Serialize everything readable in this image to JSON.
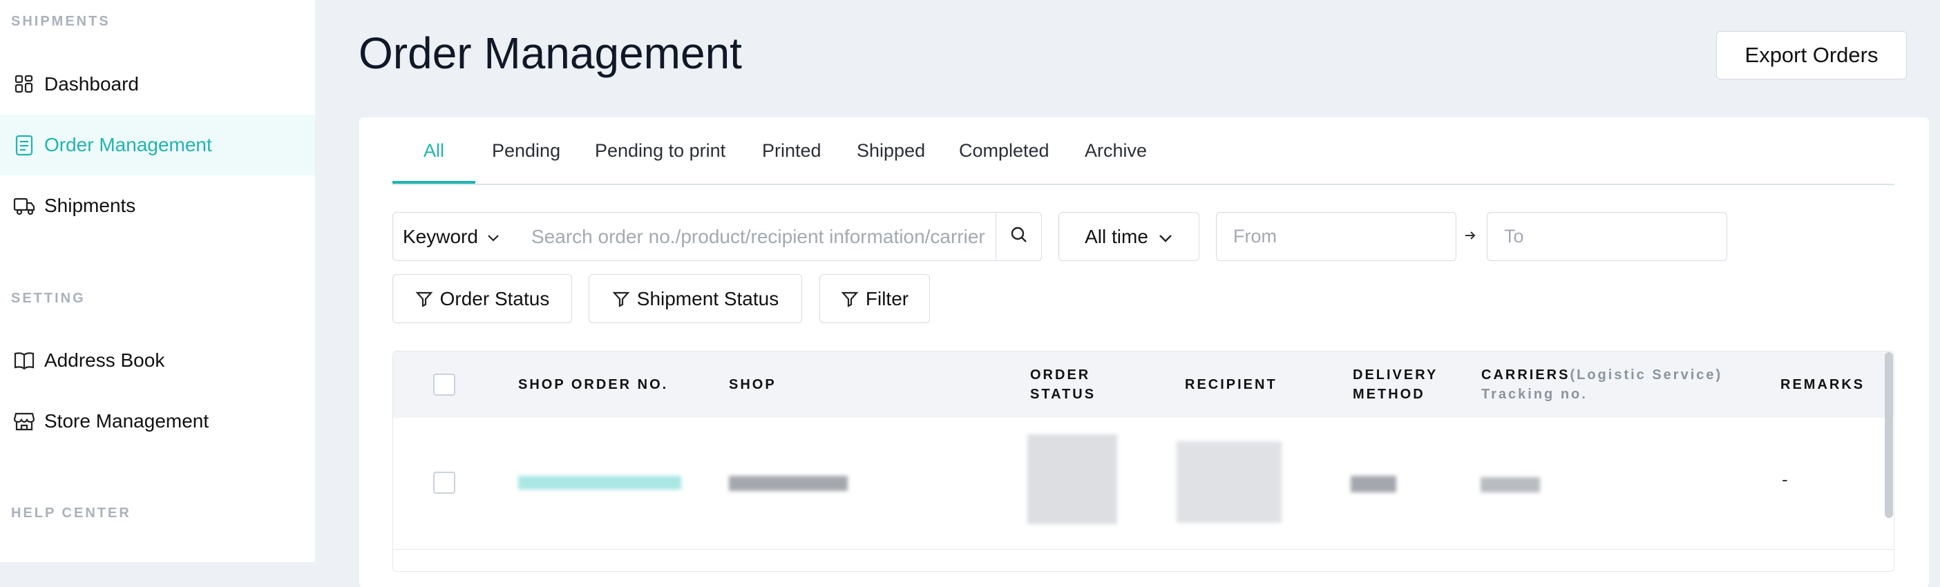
{
  "sidebar": {
    "sections": [
      {
        "label": "SHIPMENTS"
      },
      {
        "label": "SETTING"
      },
      {
        "label": "HELP CENTER"
      }
    ],
    "items": [
      {
        "label": "Dashboard",
        "icon": "dashboard-icon",
        "active": false
      },
      {
        "label": "Order Management",
        "icon": "clipboard-icon",
        "active": true
      },
      {
        "label": "Shipments",
        "icon": "truck-icon",
        "active": false
      },
      {
        "label": "Address Book",
        "icon": "book-icon",
        "active": false
      },
      {
        "label": "Store Management",
        "icon": "store-icon",
        "active": false
      }
    ]
  },
  "header": {
    "title": "Order Management",
    "export_label": "Export Orders"
  },
  "tabs": [
    {
      "label": "All",
      "active": true
    },
    {
      "label": "Pending"
    },
    {
      "label": "Pending to print"
    },
    {
      "label": "Printed"
    },
    {
      "label": "Shipped"
    },
    {
      "label": "Completed"
    },
    {
      "label": "Archive"
    }
  ],
  "search": {
    "keyword_label": "Keyword",
    "placeholder": "Search order no./product/recipient information/carrier",
    "time_label": "All time",
    "from_placeholder": "From",
    "to_placeholder": "To"
  },
  "filters": {
    "order_status": "Order Status",
    "shipment_status": "Shipment Status",
    "filter": "Filter"
  },
  "table": {
    "columns": {
      "shop_order_no": "SHOP ORDER NO.",
      "shop": "SHOP",
      "order_status_1": "ORDER",
      "order_status_2": "STATUS",
      "recipient": "RECIPIENT",
      "delivery_1": "DELIVERY",
      "delivery_2": "METHOD",
      "carriers": "CARRIERS",
      "carriers_sub": "(Logistic Service)",
      "tracking": "Tracking no.",
      "remarks": "REMARKS"
    },
    "rows": [
      {
        "remarks": "-"
      }
    ]
  },
  "colors": {
    "accent": "#22b3b0",
    "background": "#edf0f4"
  }
}
